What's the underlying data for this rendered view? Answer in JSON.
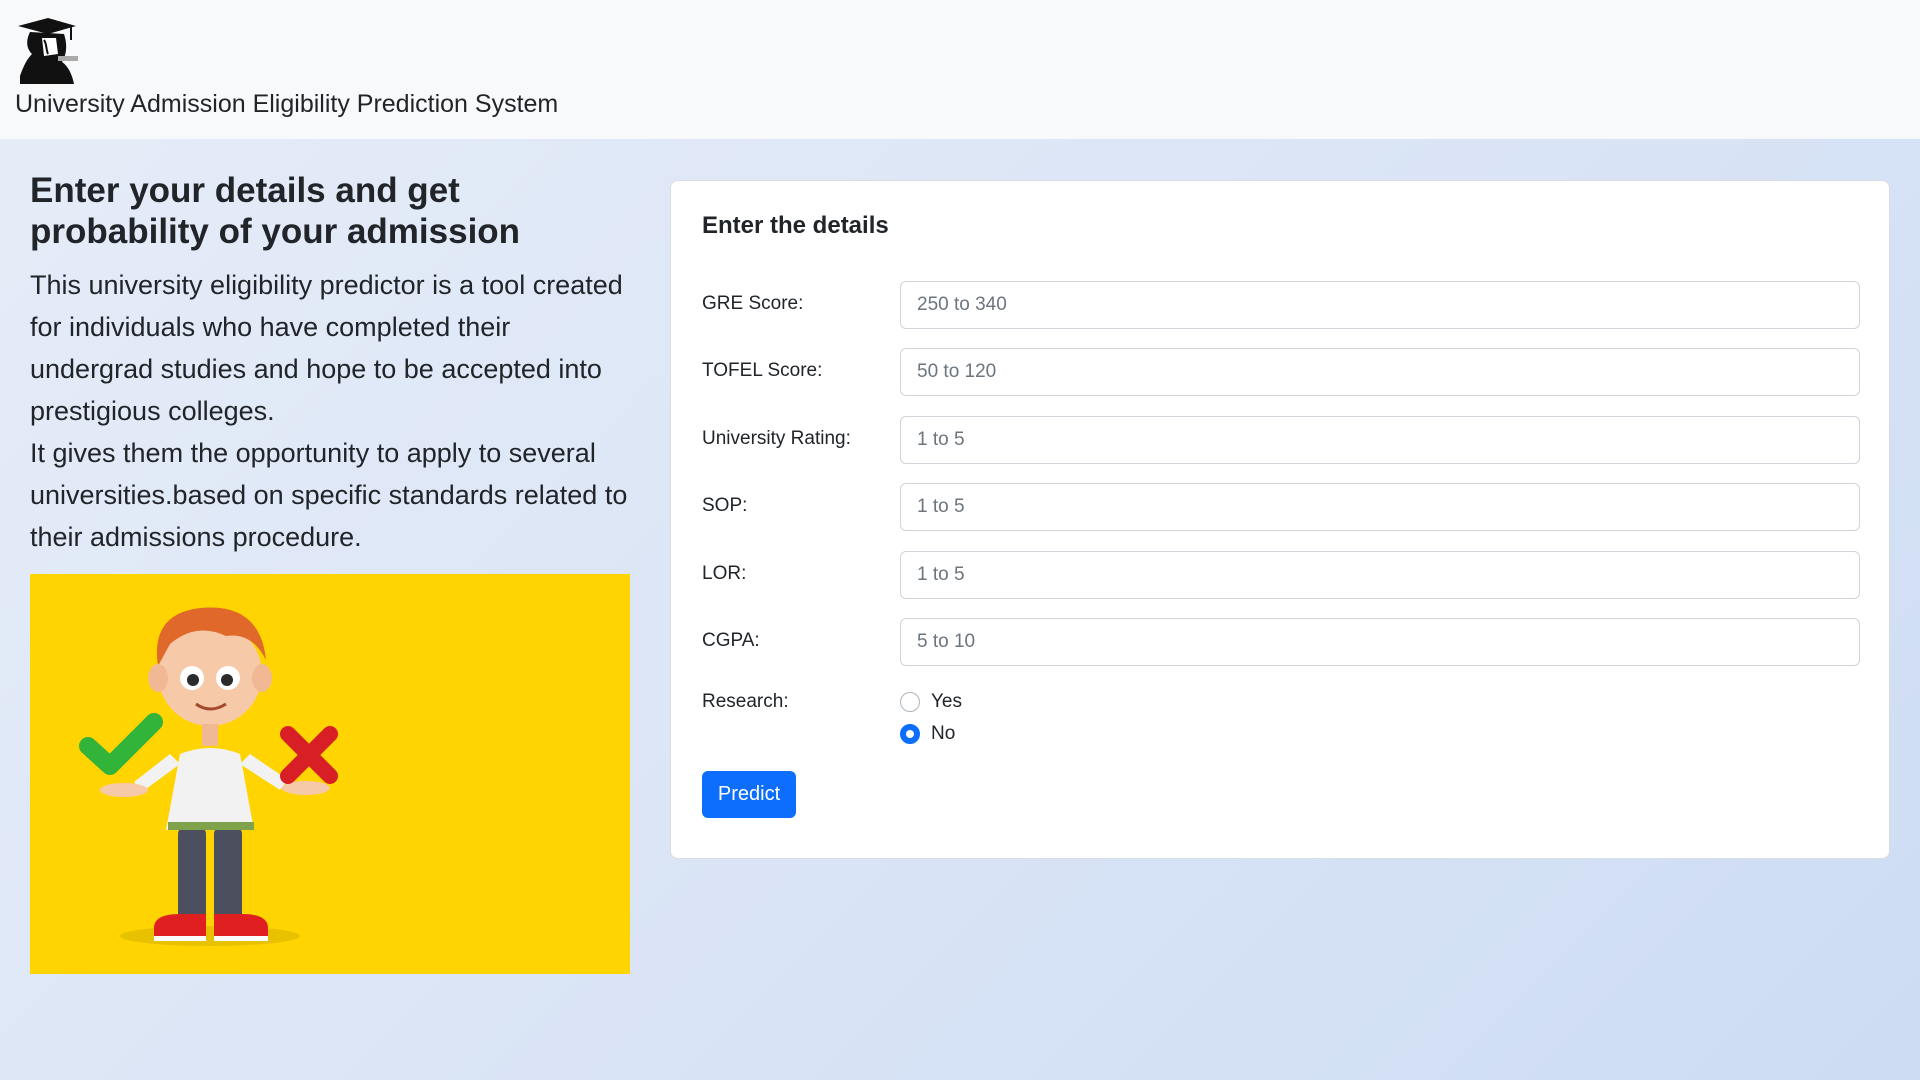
{
  "navbar": {
    "brand_text": "University Admission Eligibility Prediction System",
    "logo_icon": "graduate-cap-silhouette-icon"
  },
  "intro": {
    "heading": "Enter your details and get probability of your admission",
    "paragraph_1": "This university eligibility predictor is a tool created for individuals who have completed their undergrad studies and hope to be accepted into prestigious colleges.",
    "paragraph_2": "It gives them the opportunity to apply to several universities.based on specific standards related to their admissions procedure.",
    "illustration": "cartoon-boy-check-cross-illustration"
  },
  "form": {
    "title": "Enter the details",
    "fields": [
      {
        "label": "GRE Score:",
        "placeholder": "250 to 340",
        "value": ""
      },
      {
        "label": "TOFEL Score:",
        "placeholder": "50 to 120",
        "value": ""
      },
      {
        "label": "University Rating:",
        "placeholder": "1 to 5",
        "value": ""
      },
      {
        "label": "SOP:",
        "placeholder": "1 to 5",
        "value": ""
      },
      {
        "label": "LOR:",
        "placeholder": "1 to 5",
        "value": ""
      },
      {
        "label": "CGPA:",
        "placeholder": "5 to 10",
        "value": ""
      }
    ],
    "research": {
      "label": "Research:",
      "options": [
        "Yes",
        "No"
      ],
      "selected": "No"
    },
    "submit_label": "Predict"
  },
  "colors": {
    "accent": "#0d6efd",
    "navbar_bg": "#f8f9fa",
    "illustration_bg": "#ffd400"
  }
}
